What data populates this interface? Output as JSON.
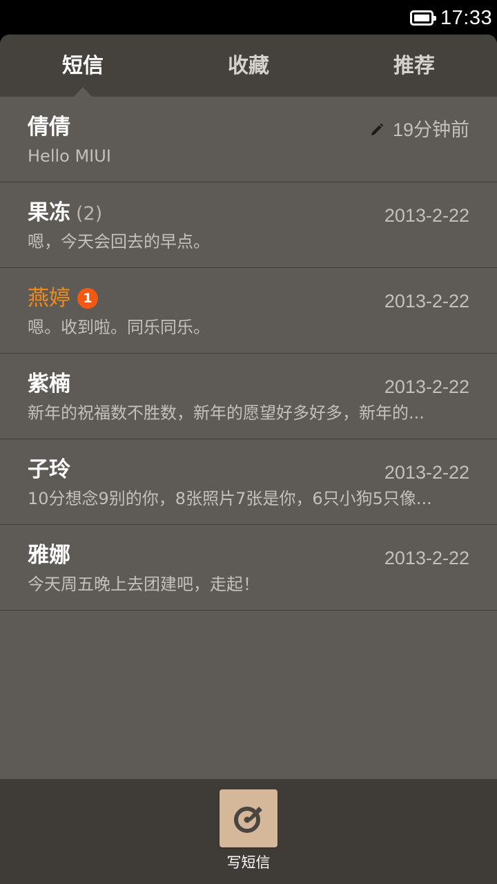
{
  "status_bar": {
    "time": "17:33",
    "battery_icon": "battery-full-icon"
  },
  "tabs": [
    {
      "label": "短信",
      "active": true
    },
    {
      "label": "收藏",
      "active": false
    },
    {
      "label": "推荐",
      "active": false
    }
  ],
  "conversations": [
    {
      "name": "倩倩",
      "count": "",
      "badge": "",
      "date": "19分钟前",
      "draft": true,
      "preview": "Hello MIUI"
    },
    {
      "name": "果冻",
      "count": "(2)",
      "badge": "",
      "date": "2013-2-22",
      "draft": false,
      "preview": "嗯，今天会回去的早点。"
    },
    {
      "name": "燕婷",
      "count": "",
      "badge": "1",
      "date": "2013-2-22",
      "draft": false,
      "preview": "嗯。收到啦。同乐同乐。"
    },
    {
      "name": "紫楠",
      "count": "",
      "badge": "",
      "date": "2013-2-22",
      "draft": false,
      "preview": "新年的祝福数不胜数，新年的愿望好多好多，新年的..."
    },
    {
      "name": "子玲",
      "count": "",
      "badge": "",
      "date": "2013-2-22",
      "draft": false,
      "preview": "10分想念9别的你，8张照片7张是你，6只小狗5只像..."
    },
    {
      "name": "雅娜",
      "count": "",
      "badge": "",
      "date": "2013-2-22",
      "draft": false,
      "preview": "今天周五晚上去团建吧，走起！"
    }
  ],
  "bottom_bar": {
    "compose_label": "写短信",
    "compose_icon": "compose-icon"
  },
  "colors": {
    "unread_name": "#f08a1c",
    "badge": "#f25a14",
    "compose_button": "#d5b79a"
  }
}
